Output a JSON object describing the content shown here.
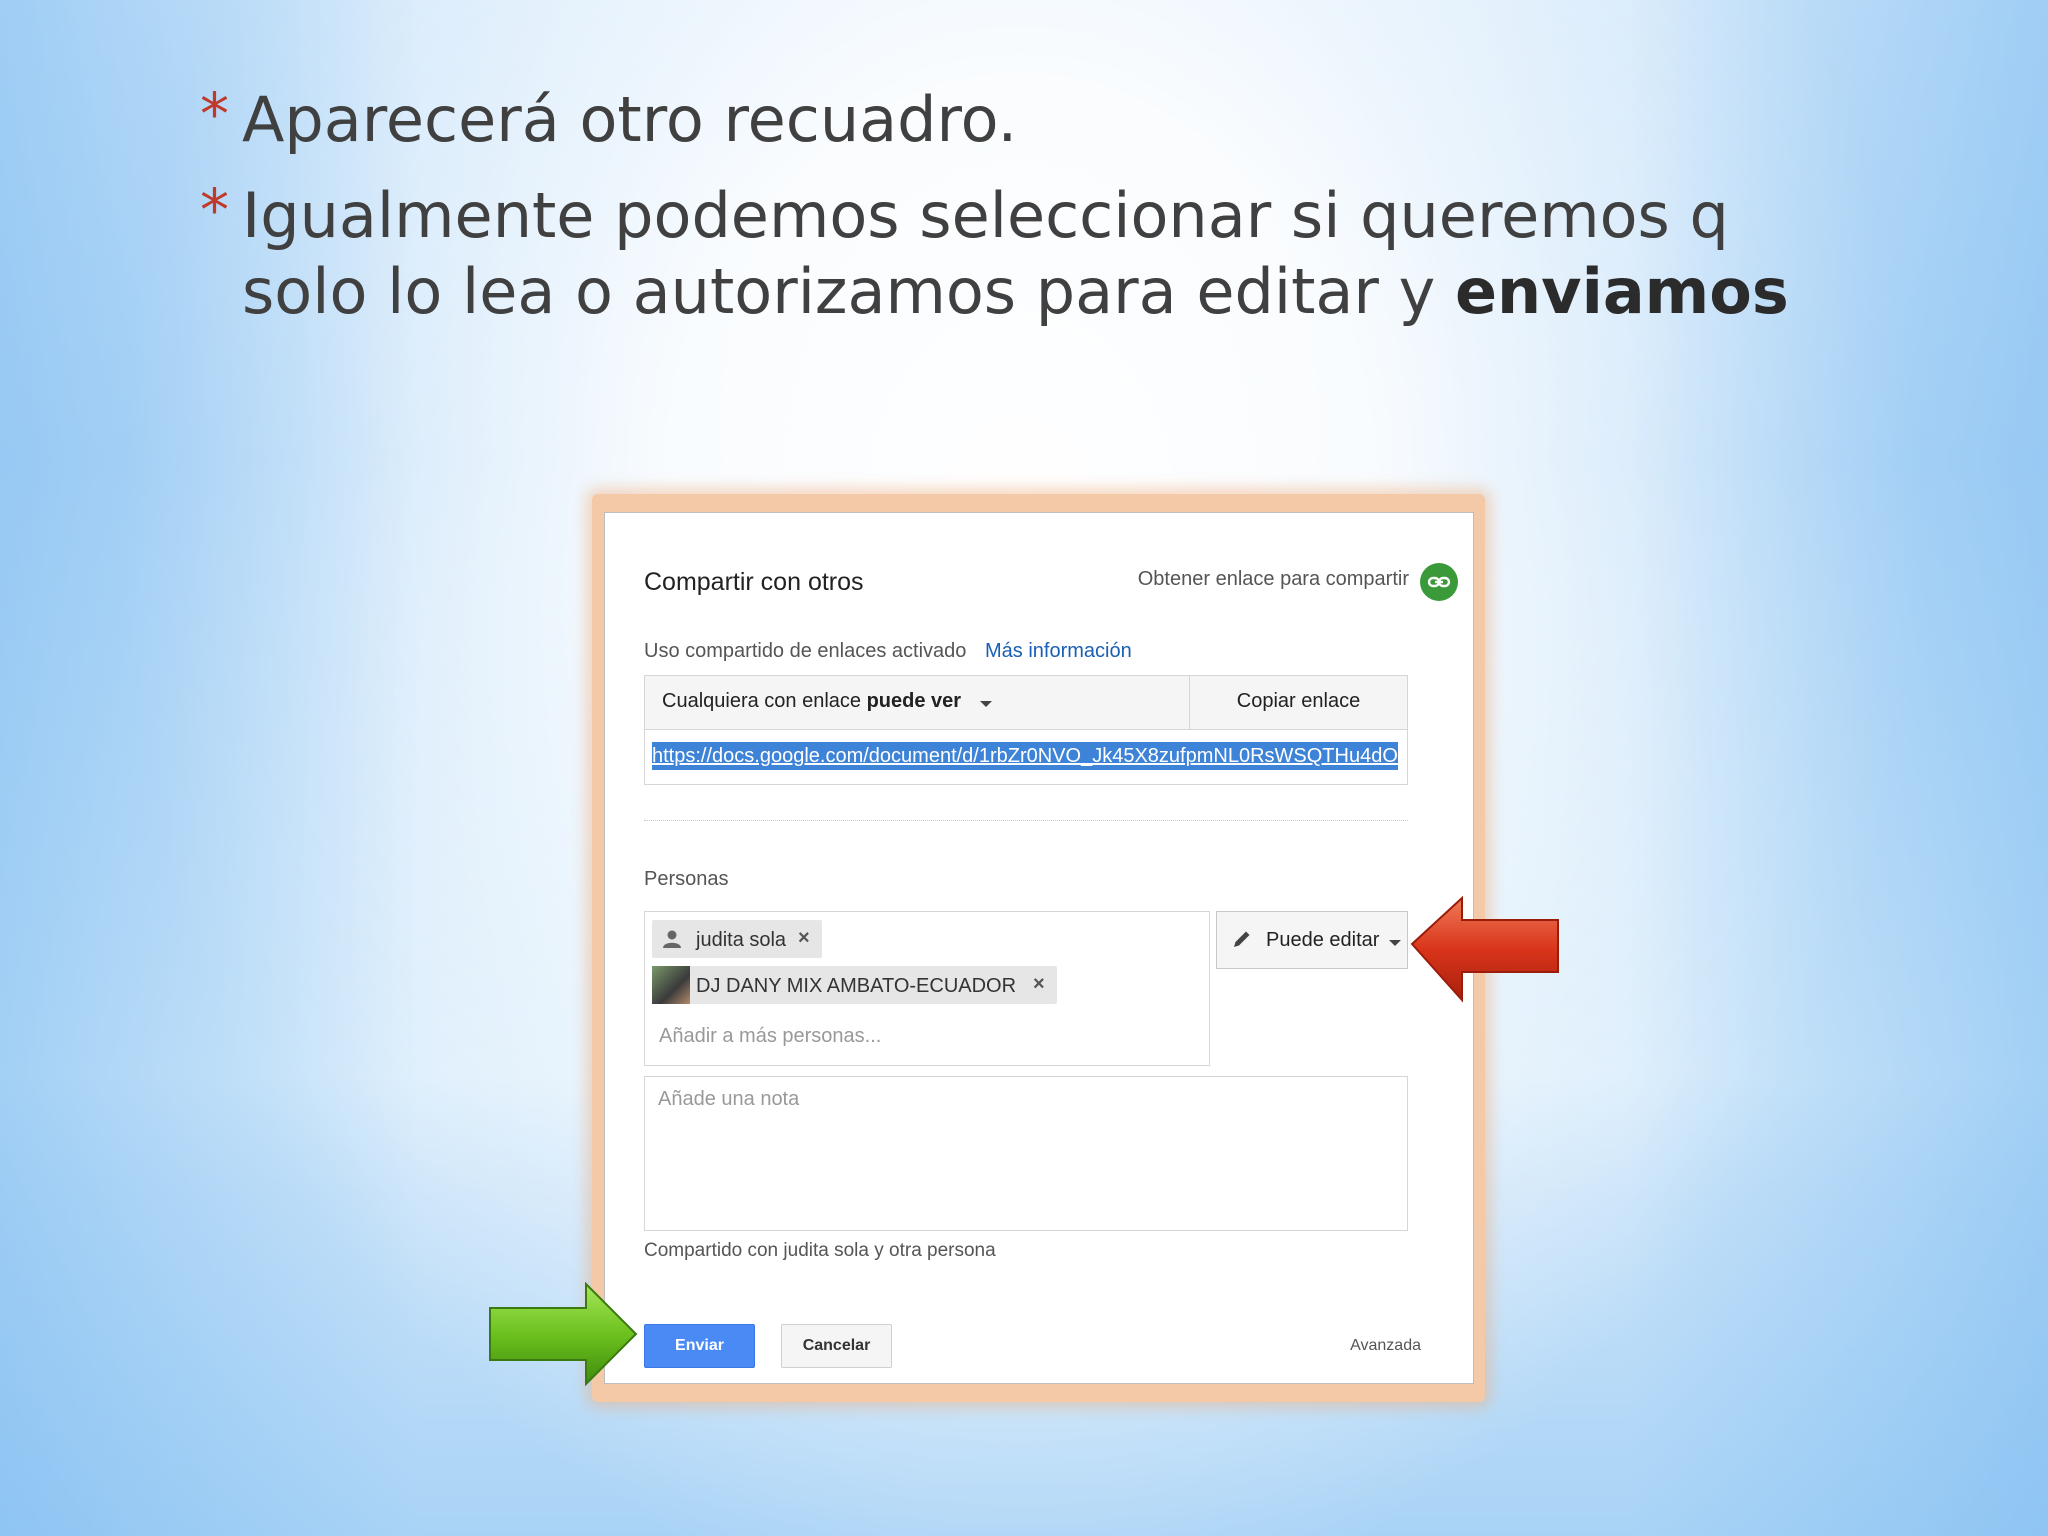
{
  "slide": {
    "bullets": [
      {
        "text": "Aparecerá otro recuadro."
      },
      {
        "text_before": "Igualmente podemos seleccionar si queremos q solo lo lea o autorizamos para editar y ",
        "text_bold": "enviamos"
      }
    ],
    "bullet_symbol": "*"
  },
  "dialog": {
    "title": "Compartir con otros",
    "get_link_label": "Obtener enlace para compartir",
    "get_link_icon": "link-icon",
    "link_sharing_status": "Uso compartido de enlaces activado",
    "more_info_link": "Más información",
    "link_permission_prefix": "Cualquiera con enlace",
    "link_permission_value": "puede ver",
    "copy_link_button": "Copiar enlace",
    "share_url": "https://docs.google.com/document/d/1rbZr0NVO_Jk45X8zufpmNL0RsWSQTHu4dO",
    "people_label": "Personas",
    "people": [
      {
        "name": "judita sola",
        "icon": "person-icon"
      },
      {
        "name": "DJ DANY MIX AMBATO-ECUADOR",
        "icon": "avatar-photo"
      }
    ],
    "add_people_placeholder": "Añadir a más personas...",
    "people_permission": "Puede editar",
    "note_placeholder": "Añade una nota",
    "shared_with_text": "Compartido con judita sola y otra persona",
    "send_button": "Enviar",
    "cancel_button": "Cancelar",
    "advanced_link": "Avanzada"
  },
  "colors": {
    "bullet_star": "#c0392b",
    "send_button": "#4a8af4",
    "link_icon": "#3a9a3a",
    "red_arrow": "#d93a1c",
    "green_arrow": "#6cc11e"
  }
}
